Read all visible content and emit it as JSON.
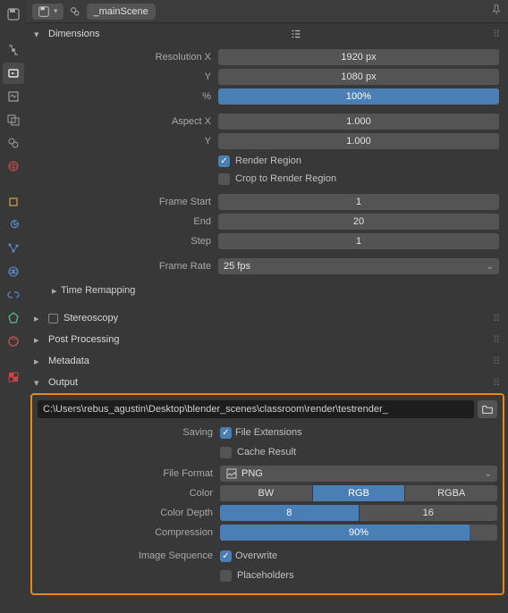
{
  "header": {
    "scene_name": "_mainScene"
  },
  "dimensions": {
    "title": "Dimensions",
    "resolution_x_label": "Resolution X",
    "resolution_x": "1920 px",
    "resolution_y_label": "Y",
    "resolution_y": "1080 px",
    "resolution_pct_label": "%",
    "resolution_pct": "100%",
    "aspect_x_label": "Aspect X",
    "aspect_x": "1.000",
    "aspect_y_label": "Y",
    "aspect_y": "1.000",
    "render_region": "Render Region",
    "crop_region": "Crop to Render Region",
    "frame_start_label": "Frame Start",
    "frame_start": "1",
    "frame_end_label": "End",
    "frame_end": "20",
    "frame_step_label": "Step",
    "frame_step": "1",
    "frame_rate_label": "Frame Rate",
    "frame_rate": "25 fps",
    "time_remapping": "Time Remapping"
  },
  "panels": {
    "stereoscopy": "Stereoscopy",
    "post_processing": "Post Processing",
    "metadata": "Metadata",
    "output": "Output"
  },
  "output": {
    "path": "C:\\Users\\rebus_agustin\\Desktop\\blender_scenes\\classroom\\render\\testrender_",
    "saving_label": "Saving",
    "file_extensions": "File Extensions",
    "cache_result": "Cache Result",
    "file_format_label": "File Format",
    "file_format": "PNG",
    "color_label": "Color",
    "color_bw": "BW",
    "color_rgb": "RGB",
    "color_rgba": "RGBA",
    "color_depth_label": "Color Depth",
    "depth_8": "8",
    "depth_16": "16",
    "compression_label": "Compression",
    "compression": "90%",
    "image_sequence_label": "Image Sequence",
    "overwrite": "Overwrite",
    "placeholders": "Placeholders"
  }
}
